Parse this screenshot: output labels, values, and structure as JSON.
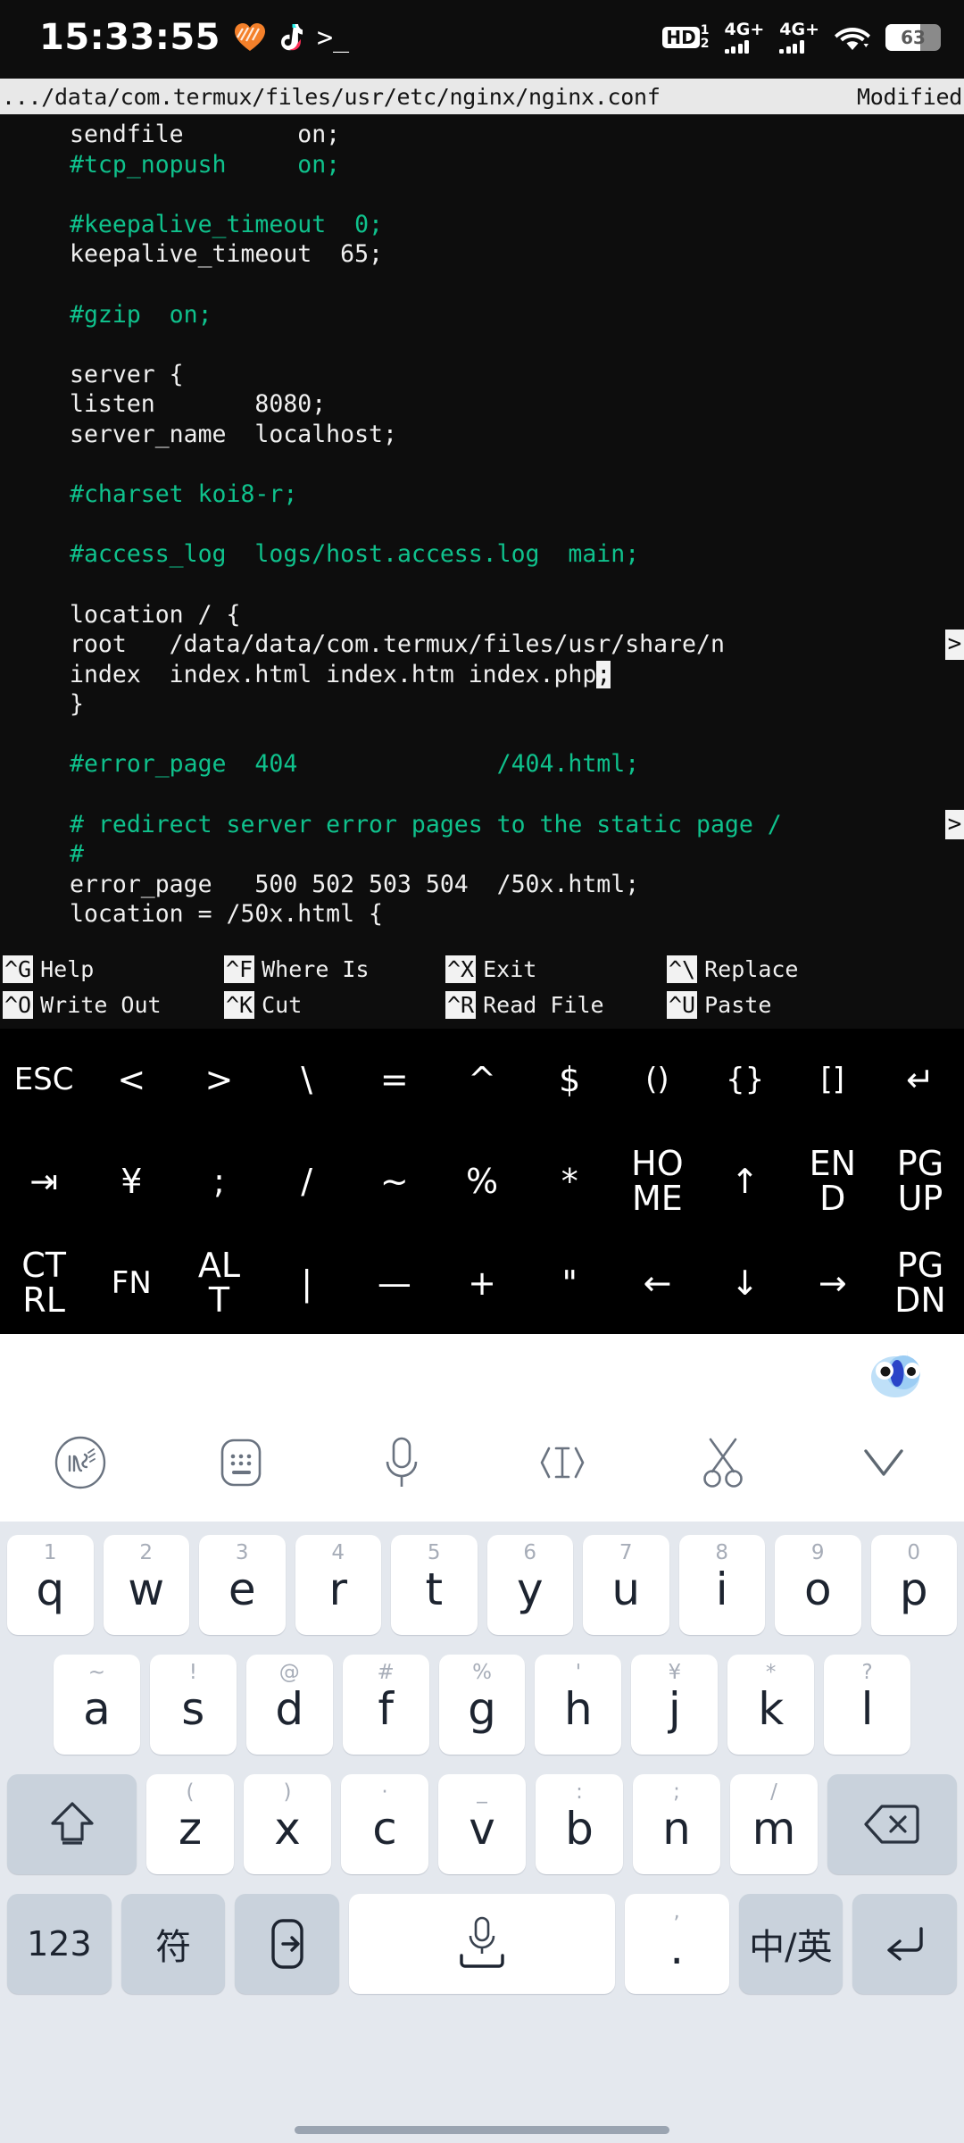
{
  "statusbar": {
    "clock": "15:33:55",
    "left_icons": [
      "heart-icon",
      "tiktok-icon",
      "terminal-prompt-icon"
    ],
    "hd_label": "HD",
    "hd_sup": "1",
    "hd_sub": "2",
    "sim1_network": "4G+",
    "sim2_network": "4G+",
    "wifi": "wifi-icon",
    "battery_percent": "63",
    "battery_level": 63
  },
  "nano": {
    "title_path": ".../data/com.termux/files/usr/etc/nginx/nginx.conf",
    "title_state": "Modified",
    "shortcuts": [
      {
        "key": "^G",
        "label": "Help"
      },
      {
        "key": "^O",
        "label": "Write Out"
      },
      {
        "key": "^F",
        "label": "Where Is"
      },
      {
        "key": "^K",
        "label": "Cut"
      },
      {
        "key": "^X",
        "label": "Exit"
      },
      {
        "key": "^R",
        "label": "Read File"
      },
      {
        "key": "^\\",
        "label": "Replace"
      },
      {
        "key": "^U",
        "label": "Paste"
      }
    ]
  },
  "terminal": {
    "lines": [
      {
        "indent": 4,
        "segments": [
          {
            "t": "sendfile        on;",
            "c": "plain"
          }
        ]
      },
      {
        "indent": 4,
        "segments": [
          {
            "t": "#tcp_nopush     on;",
            "c": "comment"
          }
        ]
      },
      {
        "indent": 0,
        "segments": [
          {
            "t": "",
            "c": "plain"
          }
        ]
      },
      {
        "indent": 4,
        "segments": [
          {
            "t": "#keepalive_timeout  0;",
            "c": "comment"
          }
        ]
      },
      {
        "indent": 4,
        "segments": [
          {
            "t": "keepalive_timeout  65;",
            "c": "plain"
          }
        ]
      },
      {
        "indent": 0,
        "segments": [
          {
            "t": "",
            "c": "plain"
          }
        ]
      },
      {
        "indent": 4,
        "segments": [
          {
            "t": "#gzip  on;",
            "c": "comment"
          }
        ]
      },
      {
        "indent": 0,
        "segments": [
          {
            "t": "",
            "c": "plain"
          }
        ]
      },
      {
        "indent": 4,
        "segments": [
          {
            "t": "server {",
            "c": "plain"
          }
        ]
      },
      {
        "indent": 8,
        "segments": [
          {
            "t": "listen       8080;",
            "c": "plain"
          }
        ]
      },
      {
        "indent": 8,
        "segments": [
          {
            "t": "server_name  localhost;",
            "c": "plain"
          }
        ]
      },
      {
        "indent": 0,
        "segments": [
          {
            "t": "",
            "c": "plain"
          }
        ]
      },
      {
        "indent": 8,
        "segments": [
          {
            "t": "#charset koi8-r;",
            "c": "comment"
          }
        ]
      },
      {
        "indent": 0,
        "segments": [
          {
            "t": "",
            "c": "plain"
          }
        ]
      },
      {
        "indent": 8,
        "segments": [
          {
            "t": "#access_log  logs/host.access.log  main;",
            "c": "comment"
          }
        ]
      },
      {
        "indent": 0,
        "segments": [
          {
            "t": "",
            "c": "plain"
          }
        ]
      },
      {
        "indent": 8,
        "segments": [
          {
            "t": "location / {",
            "c": "plain"
          }
        ]
      },
      {
        "indent": 12,
        "segments": [
          {
            "t": "root   /data/data/com.termux/files/usr/share/n",
            "c": "plain"
          }
        ],
        "cont": ">"
      },
      {
        "indent": 12,
        "segments": [
          {
            "t": "index  index.html index.htm index.php",
            "c": "plain"
          },
          {
            "t": ";",
            "c": "cursor"
          }
        ]
      },
      {
        "indent": 8,
        "segments": [
          {
            "t": "}",
            "c": "plain"
          }
        ]
      },
      {
        "indent": 0,
        "segments": [
          {
            "t": "",
            "c": "plain"
          }
        ]
      },
      {
        "indent": 8,
        "segments": [
          {
            "t": "#error_page  404              /404.html;",
            "c": "comment"
          }
        ]
      },
      {
        "indent": 0,
        "segments": [
          {
            "t": "",
            "c": "plain"
          }
        ]
      },
      {
        "indent": 8,
        "segments": [
          {
            "t": "# redirect server error pages to the static page /",
            "c": "comment"
          }
        ],
        "cont": ">"
      },
      {
        "indent": 8,
        "segments": [
          {
            "t": "#",
            "c": "comment"
          }
        ]
      },
      {
        "indent": 8,
        "segments": [
          {
            "t": "error_page   500 502 503 504  /50x.html;",
            "c": "plain"
          }
        ]
      },
      {
        "indent": 8,
        "segments": [
          {
            "t": "location = /50x.html {",
            "c": "plain"
          }
        ]
      }
    ],
    "colors": {
      "background": "#0d0d0d",
      "text": "#f0f0f0",
      "comment": "#0fc18c",
      "cursor_bg": "#f2f2f2"
    }
  },
  "extra_keys": {
    "rows": [
      [
        "ESC",
        "<",
        ">",
        "\\",
        "=",
        "^",
        "$",
        "()",
        "{}",
        "[]",
        "↵"
      ],
      [
        "⇥",
        "¥",
        ";",
        "/",
        "~",
        "%",
        "*",
        "HO\nME",
        "↑",
        "EN\nD",
        "PG\nUP"
      ],
      [
        "CT\nRL",
        "FN",
        "AL\nT",
        "|",
        "—",
        "+",
        "\"",
        "←",
        "↓",
        "→",
        "PG\nDN"
      ]
    ]
  },
  "ime_toolbar": {
    "tools": [
      "handwriting-icon",
      "keyboard-icon",
      "microphone-icon",
      "cursor-move-icon",
      "clipboard-scissors-icon",
      "chevron-down-icon"
    ],
    "logo": "ime-bird-logo"
  },
  "keyboard": {
    "row1": [
      {
        "main": "q",
        "hint": "1"
      },
      {
        "main": "w",
        "hint": "2"
      },
      {
        "main": "e",
        "hint": "3"
      },
      {
        "main": "r",
        "hint": "4"
      },
      {
        "main": "t",
        "hint": "5"
      },
      {
        "main": "y",
        "hint": "6"
      },
      {
        "main": "u",
        "hint": "7"
      },
      {
        "main": "i",
        "hint": "8"
      },
      {
        "main": "o",
        "hint": "9"
      },
      {
        "main": "p",
        "hint": "0"
      }
    ],
    "row2": [
      {
        "main": "a",
        "hint": "~"
      },
      {
        "main": "s",
        "hint": "!"
      },
      {
        "main": "d",
        "hint": "@"
      },
      {
        "main": "f",
        "hint": "#"
      },
      {
        "main": "g",
        "hint": "%"
      },
      {
        "main": "h",
        "hint": "'"
      },
      {
        "main": "j",
        "hint": "¥"
      },
      {
        "main": "k",
        "hint": "*"
      },
      {
        "main": "l",
        "hint": "?"
      }
    ],
    "row3": [
      {
        "main": "z",
        "hint": "("
      },
      {
        "main": "x",
        "hint": ")"
      },
      {
        "main": "c",
        "hint": "·"
      },
      {
        "main": "v",
        "hint": "_"
      },
      {
        "main": "b",
        "hint": ":"
      },
      {
        "main": "n",
        "hint": ";"
      },
      {
        "main": "m",
        "hint": "/"
      }
    ],
    "shift": "shift-icon",
    "backspace": "backspace-icon",
    "row4": {
      "num": "123",
      "symbol": "符",
      "layout": "layout-switch-icon",
      "space": "space-mic-key",
      "period": ".",
      "period_hint": ",",
      "lang": "中/英",
      "enter": "enter-icon"
    }
  }
}
